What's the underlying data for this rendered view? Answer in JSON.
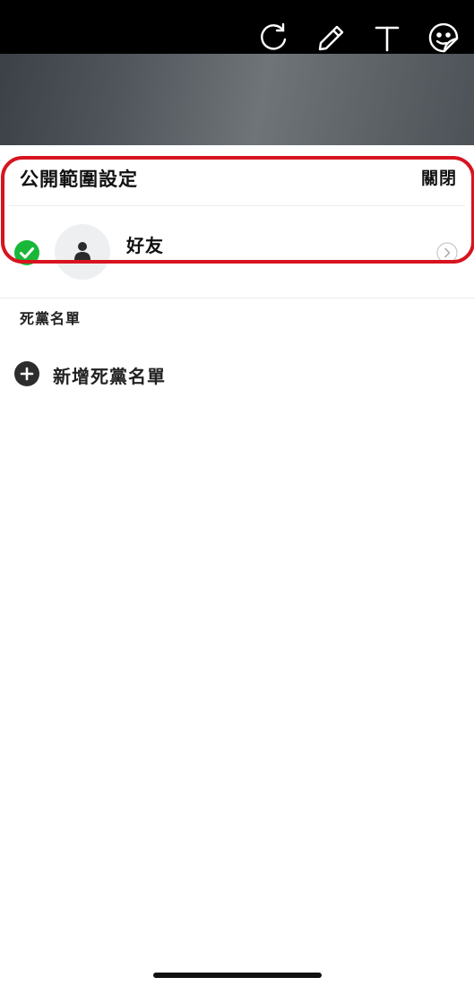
{
  "toolbar": {
    "icons": [
      "rotate-icon",
      "pen-icon",
      "text-icon",
      "sticker-icon"
    ],
    "icon_color": "#ffffff"
  },
  "privacy_sheet": {
    "title": "公開範圍設定",
    "close_label": "關閉",
    "options": [
      {
        "label": "好友",
        "selected": true,
        "check_color": "#19b839"
      }
    ]
  },
  "close_friends": {
    "section_title": "死黨名單",
    "add_label": "新增死黨名單"
  },
  "colors": {
    "highlight_border": "#d7141f",
    "top_bar": "#000000",
    "sheet_background": "#ffffff"
  }
}
